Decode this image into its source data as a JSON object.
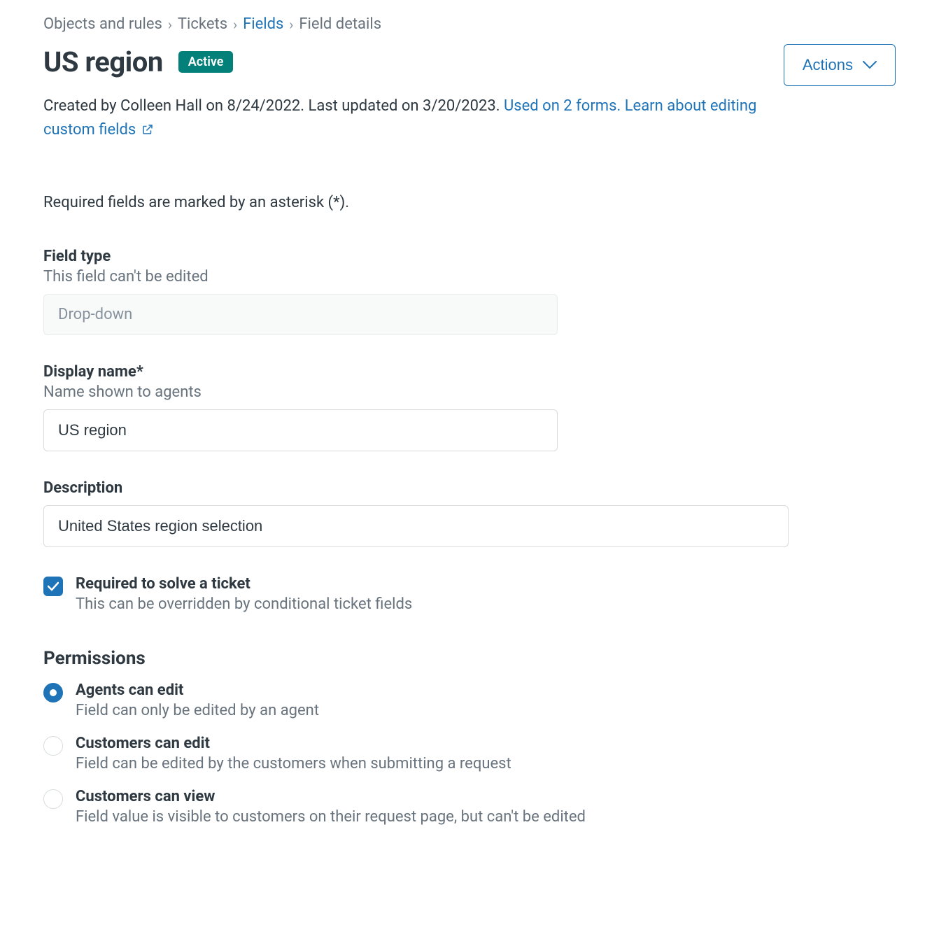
{
  "breadcrumb": {
    "item1": "Objects and rules",
    "item2": "Tickets",
    "item3": "Fields",
    "item4": "Field details"
  },
  "header": {
    "title": "US region",
    "badge": "Active",
    "actions_label": "Actions"
  },
  "meta": {
    "text_part1": "Created by Colleen Hall on 8/24/2022. Last updated on 3/20/2023. ",
    "link1": "Used on 2 forms.",
    "link2": "Learn about editing custom fields"
  },
  "note": "Required fields are marked by an asterisk (*).",
  "form": {
    "field_type": {
      "label": "Field type",
      "help": "This field can't be edited",
      "value": "Drop-down"
    },
    "display_name": {
      "label": "Display name*",
      "help": "Name shown to agents",
      "value": "US region"
    },
    "description": {
      "label": "Description",
      "value": "United States region selection"
    },
    "required": {
      "label": "Required to solve a ticket",
      "help": "This can be overridden by conditional ticket fields",
      "checked": true
    }
  },
  "permissions": {
    "title": "Permissions",
    "options": [
      {
        "label": "Agents can edit",
        "help": "Field can only be edited by an agent",
        "selected": true
      },
      {
        "label": "Customers can edit",
        "help": "Field can be edited by the customers when submitting a request",
        "selected": false
      },
      {
        "label": "Customers can view",
        "help": "Field value is visible to customers on their request page, but can't be edited",
        "selected": false
      }
    ]
  }
}
